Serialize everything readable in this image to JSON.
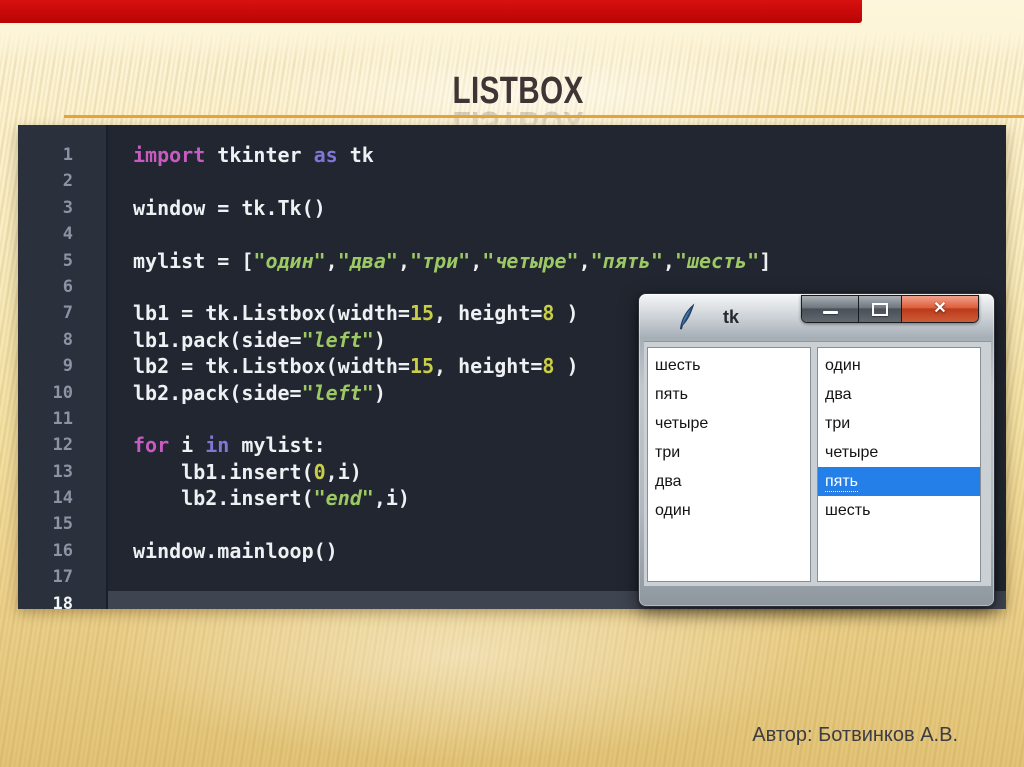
{
  "slide": {
    "title": "LISTBOX",
    "author_credit": "Автор: Ботвинков А.В.",
    "colors": {
      "top_bar": "#C60606",
      "accent_line": "#E9A43B",
      "background_top": "#FDF5D8",
      "background_bottom": "#E2C478"
    }
  },
  "editor": {
    "colors": {
      "background": "#212630",
      "gutter": "#2A313C",
      "line_numbers": "#8B93A4",
      "current_line_highlight": "#3E4450",
      "keyword": "#C75BC1",
      "keyword_secondary": "#8076D6",
      "string": "#9CC964",
      "number": "#C9CE47",
      "text": "#EEF1F4"
    },
    "lines": [
      {
        "n": 1,
        "seg": [
          [
            "kw",
            "import"
          ],
          [
            "p",
            " tkinter "
          ],
          [
            "kw2",
            "as"
          ],
          [
            "p",
            " tk"
          ]
        ]
      },
      {
        "n": 2,
        "seg": []
      },
      {
        "n": 3,
        "seg": [
          [
            "p",
            "window = tk.Tk()"
          ]
        ]
      },
      {
        "n": 4,
        "seg": []
      },
      {
        "n": 5,
        "seg": [
          [
            "p",
            "mylist = ["
          ],
          [
            "str",
            "\"один\""
          ],
          [
            "p",
            ","
          ],
          [
            "str",
            "\"два\""
          ],
          [
            "p",
            ","
          ],
          [
            "str",
            "\"три\""
          ],
          [
            "p",
            ","
          ],
          [
            "str",
            "\"четыре\""
          ],
          [
            "p",
            ","
          ],
          [
            "str",
            "\"пять\""
          ],
          [
            "p",
            ","
          ],
          [
            "str",
            "\"шесть\""
          ],
          [
            "p",
            "]"
          ]
        ]
      },
      {
        "n": 6,
        "seg": []
      },
      {
        "n": 7,
        "seg": [
          [
            "p",
            "lb1 = tk.Listbox(width="
          ],
          [
            "num",
            "15"
          ],
          [
            "p",
            ", height="
          ],
          [
            "num",
            "8"
          ],
          [
            "p",
            " )"
          ]
        ]
      },
      {
        "n": 8,
        "seg": [
          [
            "p",
            "lb1.pack(side="
          ],
          [
            "str",
            "\"left\""
          ],
          [
            "p",
            ")"
          ]
        ]
      },
      {
        "n": 9,
        "seg": [
          [
            "p",
            "lb2 = tk.Listbox(width="
          ],
          [
            "num",
            "15"
          ],
          [
            "p",
            ", height="
          ],
          [
            "num",
            "8"
          ],
          [
            "p",
            " )"
          ]
        ]
      },
      {
        "n": 10,
        "seg": [
          [
            "p",
            "lb2.pack(side="
          ],
          [
            "str",
            "\"left\""
          ],
          [
            "p",
            ")"
          ]
        ]
      },
      {
        "n": 11,
        "seg": []
      },
      {
        "n": 12,
        "seg": [
          [
            "kw",
            "for"
          ],
          [
            "p",
            " i "
          ],
          [
            "kw2",
            "in"
          ],
          [
            "p",
            " mylist:"
          ]
        ]
      },
      {
        "n": 13,
        "seg": [
          [
            "p",
            "    lb1.insert("
          ],
          [
            "num",
            "0"
          ],
          [
            "p",
            ",i)"
          ]
        ]
      },
      {
        "n": 14,
        "seg": [
          [
            "p",
            "    lb2.insert("
          ],
          [
            "str",
            "\"end\""
          ],
          [
            "p",
            ",i)"
          ]
        ]
      },
      {
        "n": 15,
        "seg": []
      },
      {
        "n": 16,
        "seg": [
          [
            "p",
            "window.mainloop()"
          ]
        ]
      },
      {
        "n": 17,
        "seg": []
      },
      {
        "n": 18,
        "seg": [],
        "highlight": true
      }
    ]
  },
  "tk_window": {
    "title": "tk",
    "window_icon": "python-feather-icon",
    "controls": [
      "minimize",
      "maximize",
      "close"
    ],
    "selection_color": "#2480E8",
    "listbox_left": {
      "items": [
        "шесть",
        "пять",
        "четыре",
        "три",
        "два",
        "один"
      ]
    },
    "listbox_right": {
      "items": [
        "один",
        "два",
        "три",
        "четыре",
        "пять",
        "шесть"
      ],
      "selected_index": 4,
      "selected_item": "пять"
    }
  }
}
